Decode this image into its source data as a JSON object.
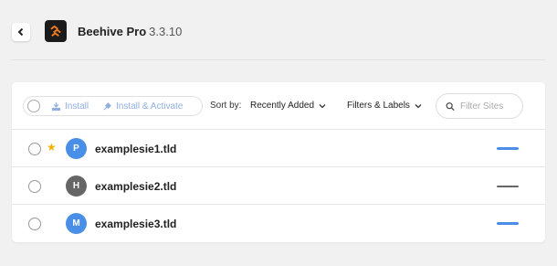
{
  "header": {
    "plugin_name": "Beehive Pro",
    "version": "3.3.10"
  },
  "toolbar": {
    "bulk_actions": [
      {
        "label": "Install",
        "icon": "install-icon"
      },
      {
        "label": "Install & Activate",
        "icon": "plugin-icon"
      }
    ],
    "sort_label": "Sort by:",
    "sort_value": "Recently Added",
    "filters_label": "Filters & Labels",
    "search_placeholder": "Filter Sites"
  },
  "sites": [
    {
      "name": "examplesie1.tld",
      "avatar": "P",
      "avatar_color": "#4a8fe7",
      "starred": true,
      "status_color": "#4a8fe7"
    },
    {
      "name": "examplesie2.tld",
      "avatar": "H",
      "avatar_color": "#666666",
      "starred": false,
      "status_color": "#666666"
    },
    {
      "name": "examplesie3.tld",
      "avatar": "M",
      "avatar_color": "#4a8fe7",
      "starred": false,
      "status_color": "#4a8fe7"
    }
  ],
  "colors": {
    "accent": "#4a8fe7",
    "star": "#f0b400",
    "logo_bg": "#1b1b1b",
    "logo_mark": "#f47b20"
  }
}
